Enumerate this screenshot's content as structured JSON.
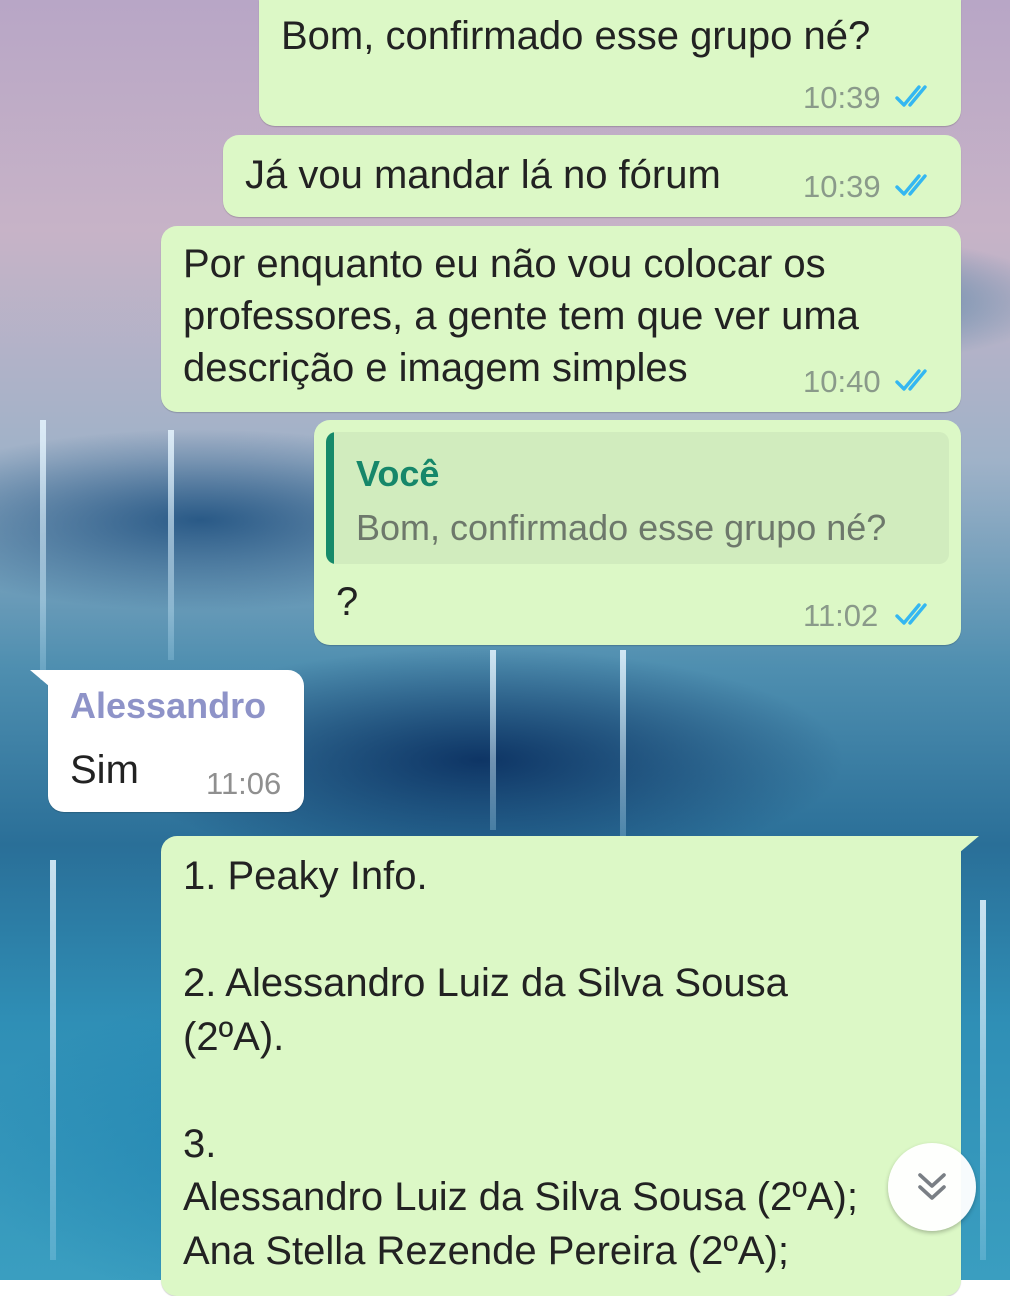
{
  "chat": {
    "messages": [
      {
        "text": "Bom, confirmado esse grupo né?",
        "time": "10:39",
        "status": "read"
      },
      {
        "text": "Já vou mandar lá no fórum",
        "time": "10:39",
        "status": "read"
      },
      {
        "text": "Por enquanto eu não vou colocar os\nprofessores, a gente tem que ver uma\ndescrição e imagem simples",
        "time": "10:40",
        "status": "read"
      },
      {
        "reply": {
          "author": "Você",
          "text": "Bom, confirmado esse grupo né?"
        },
        "text": "?",
        "time": "11:02",
        "status": "read"
      },
      {
        "sender": "Alessandro",
        "text": "Sim",
        "time": "11:06"
      },
      {
        "text": "1. Peaky Info.\n\n2. Alessandro Luiz da Silva Sousa\n(2ºA).\n\n3.\nAlessandro Luiz da Silva Sousa (2ºA);\nAna Stella Rezende Pereira (2ºA);"
      }
    ]
  },
  "colors": {
    "outgoing_bubble": "#dcf8c6",
    "incoming_bubble": "#ffffff",
    "read_ticks": "#34b7f1",
    "quote_author": "#16876a",
    "sender_name": "#8e93c8"
  },
  "icons": {
    "read_receipt": "double-check-icon",
    "scroll_down": "double-chevron-down-icon"
  }
}
